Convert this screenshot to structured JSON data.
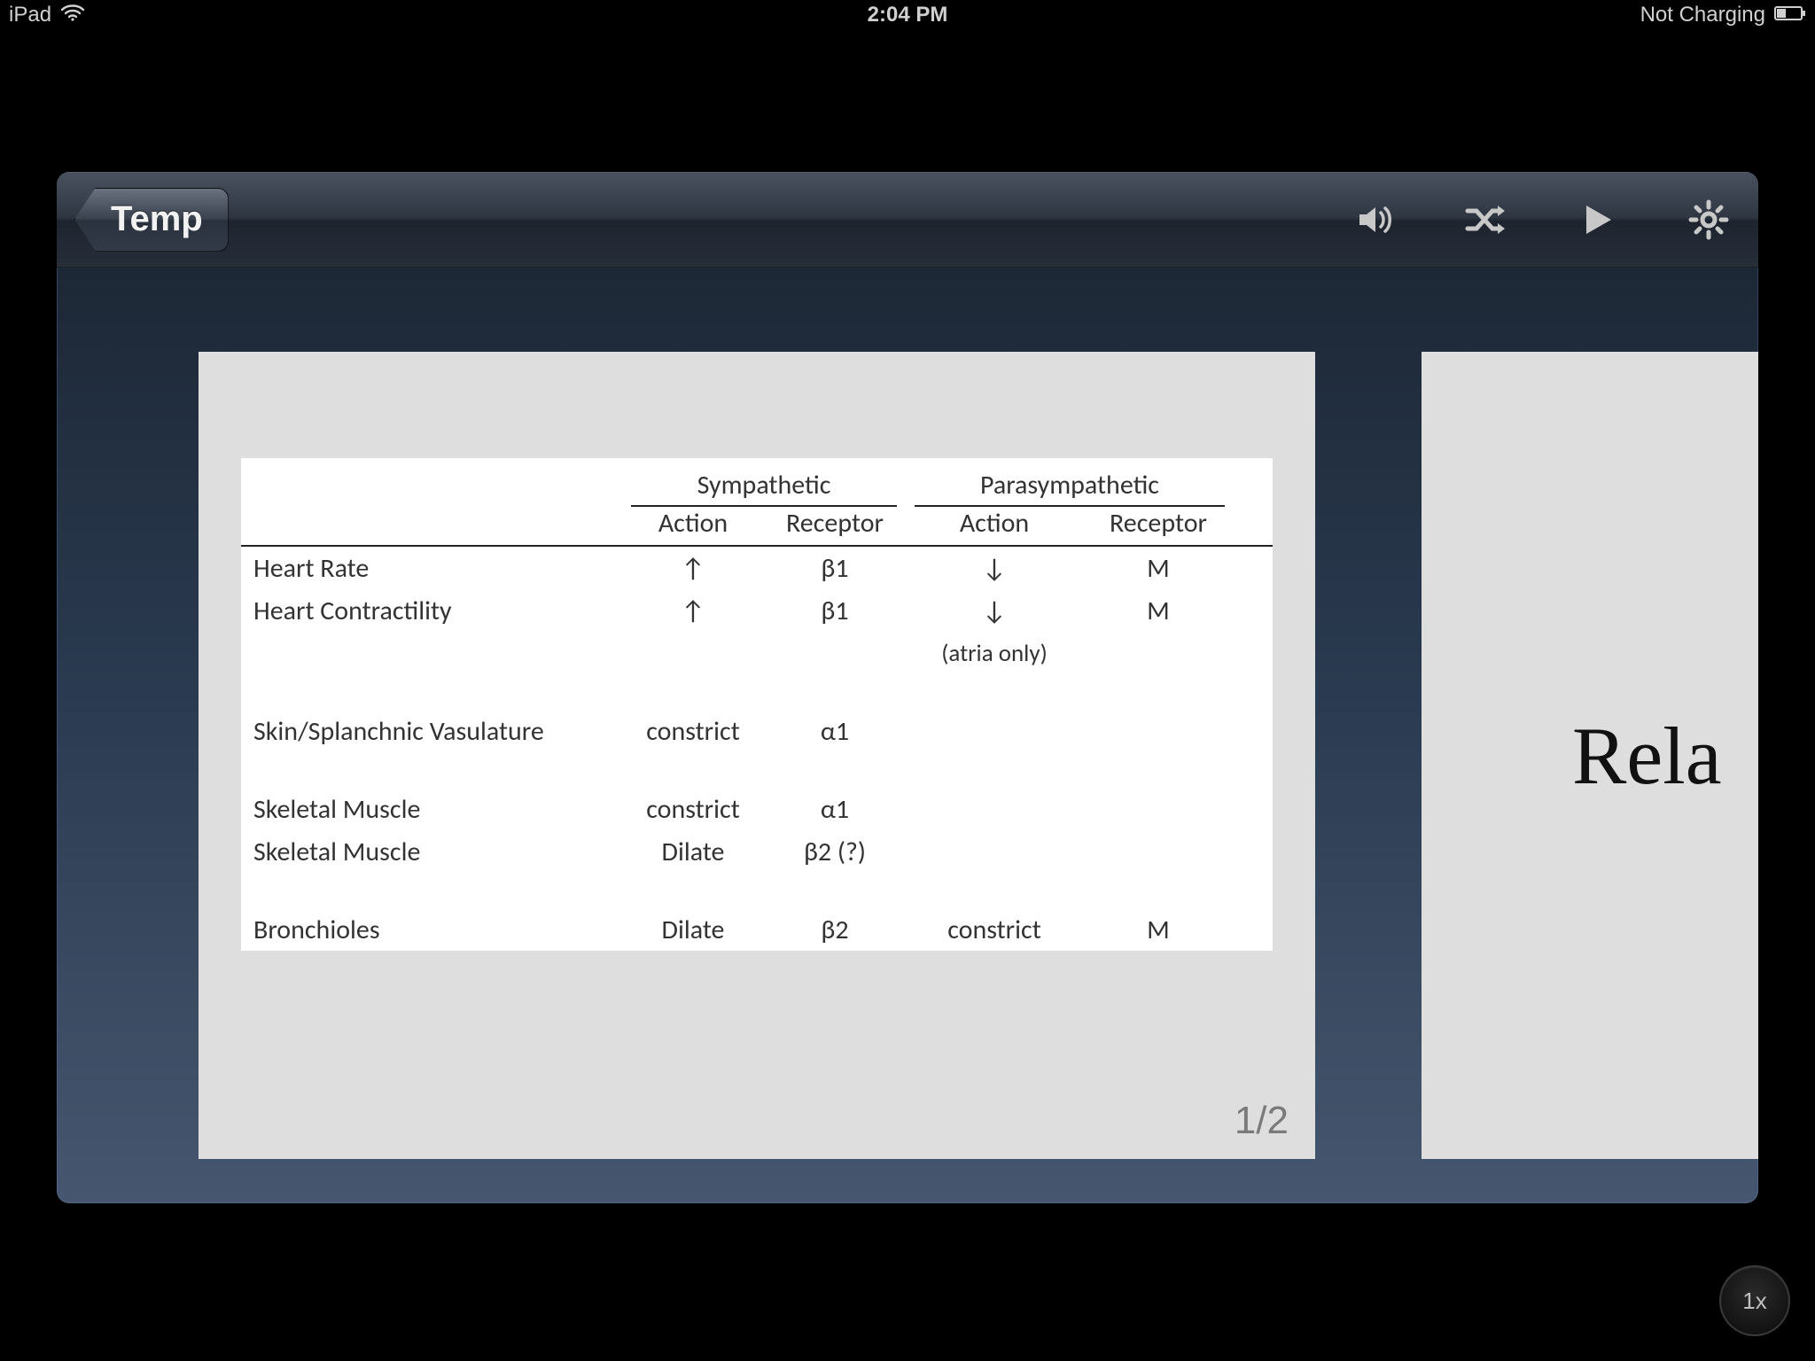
{
  "status": {
    "device": "iPad",
    "time": "2:04 PM",
    "battery_text": "Not Charging"
  },
  "toolbar": {
    "back_label": "Temp"
  },
  "card": {
    "page_indicator": "1/2",
    "next_preview_text": "Rela"
  },
  "scale_badge": "1x",
  "table": {
    "group_headers": {
      "symp": "Sympathetic",
      "para": "Parasympathetic"
    },
    "sub_headers": {
      "action": "Action",
      "receptor": "Receptor"
    },
    "rows": [
      {
        "label": "Heart Rate",
        "s_action": "↑",
        "s_receptor": "β1",
        "p_action": "↓",
        "p_receptor": "M"
      },
      {
        "label": "Heart Contractility",
        "s_action": "↑",
        "s_receptor": "β1",
        "p_action": "↓",
        "p_receptor": "M"
      },
      {
        "label": "",
        "s_action": "",
        "s_receptor": "",
        "p_action": "(atria only)",
        "p_receptor": ""
      },
      {
        "gap": true
      },
      {
        "label": "Skin/Splanchnic Vasulature",
        "s_action": "constrict",
        "s_receptor": "α1",
        "p_action": "",
        "p_receptor": ""
      },
      {
        "gap": true
      },
      {
        "label": "Skeletal Muscle",
        "s_action": "constrict",
        "s_receptor": "α1",
        "p_action": "",
        "p_receptor": ""
      },
      {
        "label": "Skeletal Muscle",
        "s_action": "Dilate",
        "s_receptor": "β2 (?)",
        "p_action": "",
        "p_receptor": ""
      },
      {
        "gap": true
      },
      {
        "label": "Bronchioles",
        "s_action": "Dilate",
        "s_receptor": "β2",
        "p_action": "constrict",
        "p_receptor": "M"
      }
    ]
  }
}
